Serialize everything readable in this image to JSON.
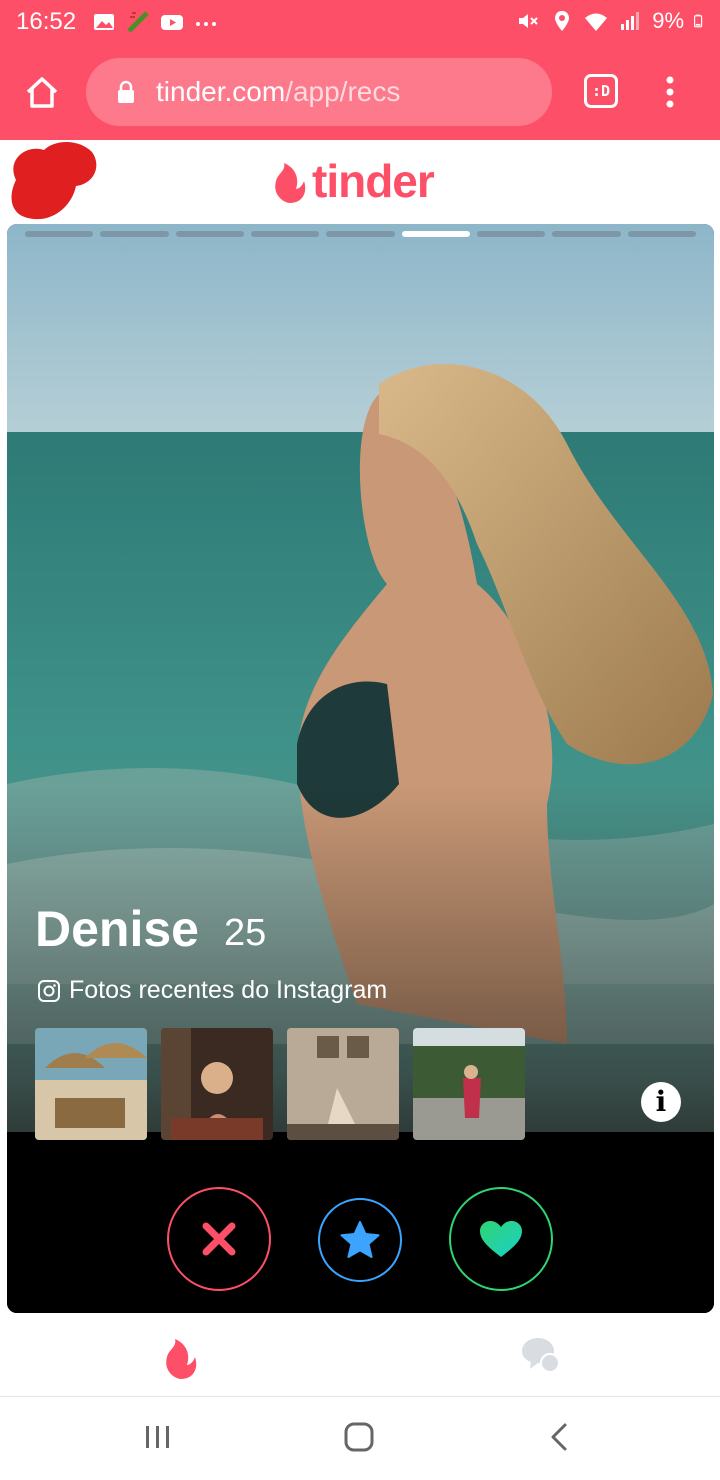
{
  "status_bar": {
    "time": "16:52",
    "battery": "9%",
    "left_icons": [
      "gallery-icon",
      "fake-gps-icon",
      "youtube-icon",
      "more-notifications-icon"
    ],
    "right_icons": [
      "mute-icon",
      "location-icon",
      "wifi-icon",
      "signal-icon",
      "battery-icon"
    ]
  },
  "browser": {
    "url_host": "tinder.com",
    "url_path": "/app/recs",
    "tab_switcher_label": ":D"
  },
  "header": {
    "logo_text": "tinder"
  },
  "card": {
    "photo_count": 9,
    "active_photo_index": 5,
    "name": "Denise",
    "age": "25",
    "instagram_label": "Fotos recentes do Instagram",
    "instagram_thumbnail_count": 4,
    "info_label": "i"
  },
  "actions": {
    "nope": "close-icon",
    "super_like": "star-icon",
    "like": "heart-icon"
  },
  "tabs": {
    "discover": "flame-icon",
    "messages": "chat-bubbles-icon"
  },
  "colors": {
    "brand": "#fd5068",
    "nope": "#fd5068",
    "super_like": "#3ca4ff",
    "like": "#2ed573"
  }
}
